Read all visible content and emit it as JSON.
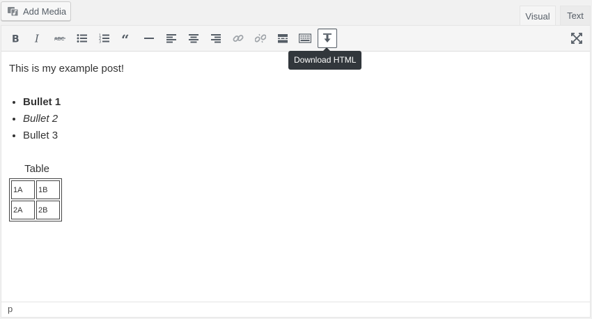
{
  "add_media": {
    "label": "Add Media"
  },
  "tabs": {
    "visual": "Visual",
    "text": "Text"
  },
  "toolbar": {
    "buttons": [
      {
        "name": "bold-button",
        "icon": "bold-icon"
      },
      {
        "name": "italic-button",
        "icon": "italic-icon"
      },
      {
        "name": "strikethrough-button",
        "icon": "strikethrough-icon"
      },
      {
        "name": "bulleted-list-button",
        "icon": "bulleted-list-icon"
      },
      {
        "name": "numbered-list-button",
        "icon": "numbered-list-icon"
      },
      {
        "name": "blockquote-button",
        "icon": "quote-icon"
      },
      {
        "name": "horizontal-line-button",
        "icon": "horizontal-line-icon"
      },
      {
        "name": "align-left-button",
        "icon": "align-left-icon"
      },
      {
        "name": "align-center-button",
        "icon": "align-center-icon"
      },
      {
        "name": "align-right-button",
        "icon": "align-right-icon"
      },
      {
        "name": "insert-link-button",
        "icon": "link-icon",
        "disabled": true
      },
      {
        "name": "remove-link-button",
        "icon": "unlink-icon",
        "disabled": true
      },
      {
        "name": "read-more-button",
        "icon": "read-more-icon"
      },
      {
        "name": "toolbar-toggle-button",
        "icon": "keyboard-icon"
      },
      {
        "name": "download-html-button",
        "icon": "download-icon",
        "active": true
      },
      {
        "name": "fullscreen-button",
        "icon": "fullscreen-icon"
      }
    ],
    "tooltip": "Download HTML"
  },
  "content": {
    "paragraph": "This is my example post!",
    "bullets": [
      "Bullet 1",
      "Bullet 2",
      "Bullet 3"
    ],
    "table_caption": "Table",
    "table_rows": [
      [
        "1A",
        "1B"
      ],
      [
        "2A",
        "2B"
      ]
    ]
  },
  "status_bar": {
    "path": "p"
  },
  "colors": {
    "icon": "#555d66",
    "disabled_icon": "#a0a5aa",
    "tooltip_bg": "#32373c"
  }
}
